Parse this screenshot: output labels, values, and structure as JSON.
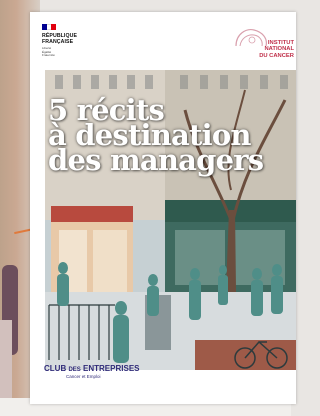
{
  "brochure": {
    "republique": "RÉPUBLIQUE\nFRANÇAISE",
    "motto": "Liberté\nÉgalité\nFraternité",
    "institut": "INSTITUT\nNATIONAL\nDU CANCER",
    "title_lines": [
      "5 récits",
      "à destination",
      "des managers"
    ],
    "club_name_part1": "CLUB",
    "club_name_part2": "DES",
    "club_name_part3": "ENTREPRISES",
    "club_subtitle": "Cancer et Emploi"
  },
  "colors": {
    "flag_blue": "#000091",
    "flag_white": "#ffffff",
    "flag_red": "#e1000f",
    "inca_red": "#c0304a",
    "club_navy": "#2f2a78",
    "accent_orange": "#e07a3c"
  },
  "icons": [
    "marianne-flag-icon",
    "institut-cancer-logo-icon"
  ]
}
